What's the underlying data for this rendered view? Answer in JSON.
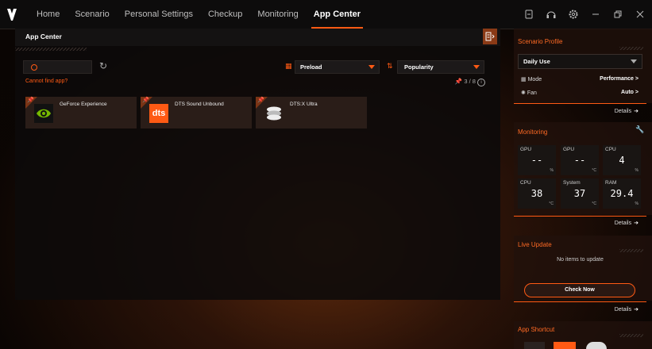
{
  "nav": {
    "items": [
      "Home",
      "Scenario",
      "Personal Settings",
      "Checkup",
      "Monitoring",
      "App Center"
    ],
    "active_index": 5
  },
  "window_icons": [
    "profile-icon",
    "headset-icon",
    "settings-icon",
    "minimize-icon",
    "restore-icon",
    "close-icon"
  ],
  "main": {
    "title": "App Center",
    "search_placeholder": "",
    "filter": {
      "label": "Preload"
    },
    "sort": {
      "label": "Popularity"
    },
    "cannot_find": "Cannot find app?",
    "pin_count": "3 / 8",
    "apps": [
      {
        "name": "GeForce Experience",
        "icon": "geforce-icon"
      },
      {
        "name": "DTS Sound Unbound",
        "icon": "dts-icon",
        "icon_text": "dts"
      },
      {
        "name": "DTS:X Ultra",
        "icon": "dtsx-icon"
      }
    ]
  },
  "sidebar": {
    "scenario": {
      "title": "Scenario Profile",
      "profile": "Daily Use",
      "mode_label": "Mode",
      "mode_value": "Performance >",
      "fan_label": "Fan",
      "fan_value": "Auto >",
      "details": "Details"
    },
    "monitoring": {
      "title": "Monitoring",
      "metrics": [
        {
          "label": "GPU",
          "value": "--",
          "unit": "%"
        },
        {
          "label": "GPU",
          "value": "--",
          "unit": "°C"
        },
        {
          "label": "CPU",
          "value": "4",
          "unit": "%"
        },
        {
          "label": "CPU",
          "value": "38",
          "unit": "°C"
        },
        {
          "label": "System",
          "value": "37",
          "unit": "°C"
        },
        {
          "label": "RAM",
          "value": "29.4",
          "unit": "%"
        }
      ],
      "details": "Details"
    },
    "live_update": {
      "title": "Live Update",
      "message": "No items to update",
      "check_now": "Check Now",
      "details": "Details"
    },
    "app_shortcut": {
      "title": "App Shortcut"
    }
  },
  "colors": {
    "accent": "#ff5a14",
    "panel": "#0c0a0a",
    "card": "#2a1d18"
  }
}
